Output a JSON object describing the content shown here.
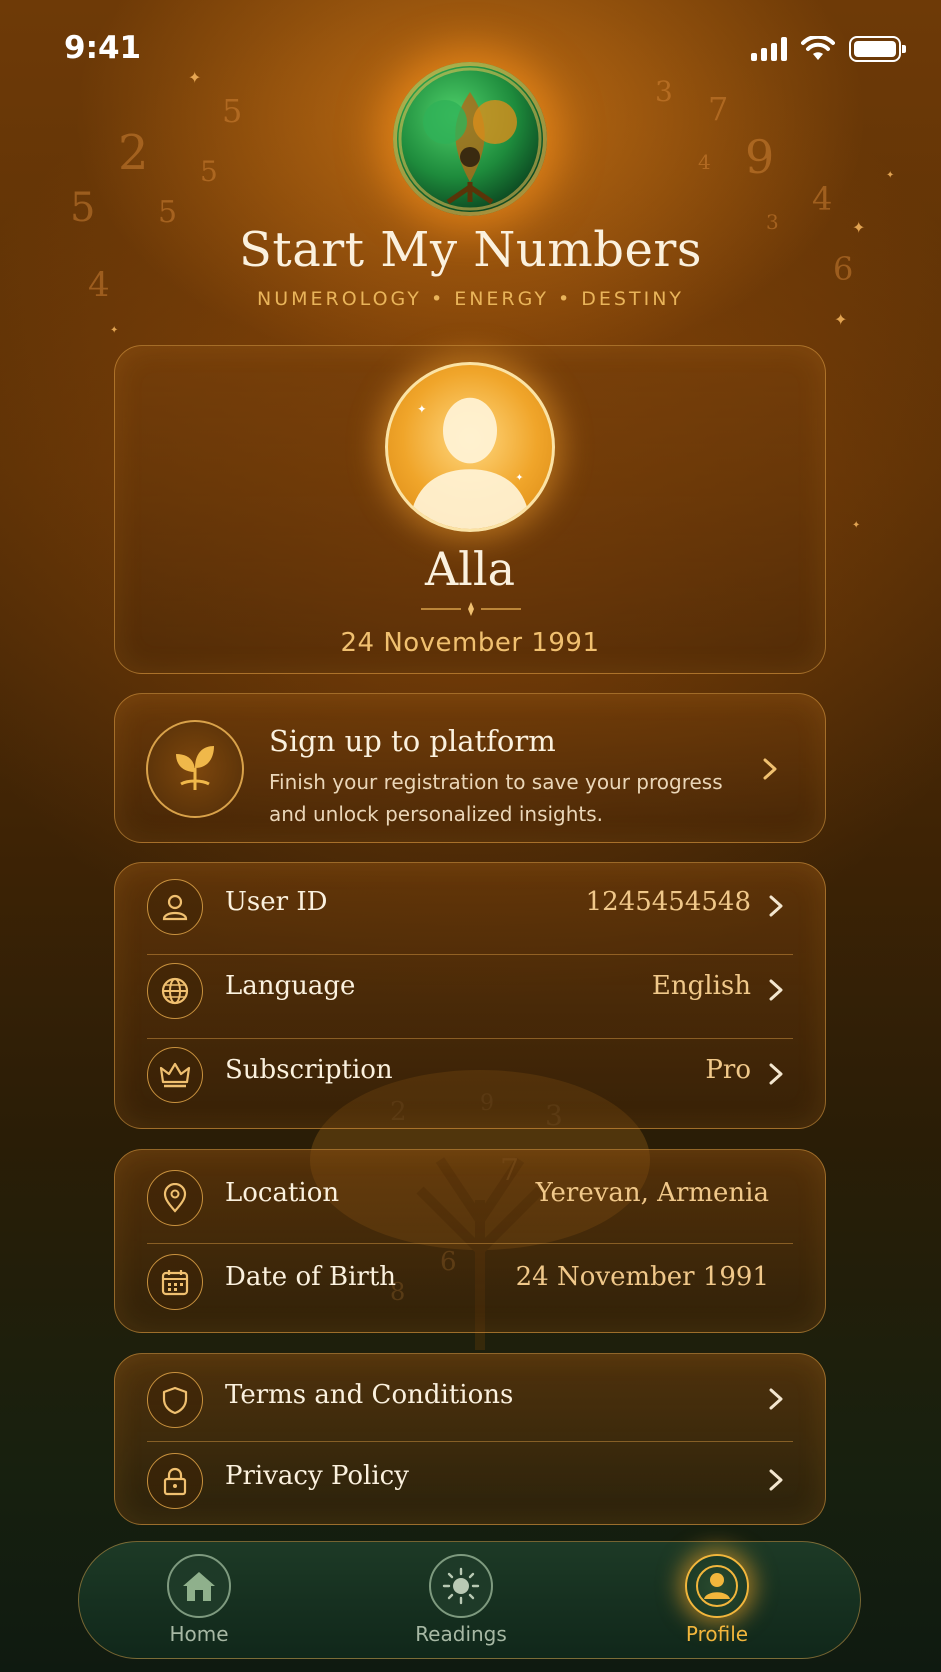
{
  "status_bar": {
    "time": "9:41"
  },
  "header": {
    "title": "Start My Numbers",
    "subtitle": "NUMEROLOGY • ENERGY • DESTINY"
  },
  "profile": {
    "name": "Alla",
    "date_of_birth": "24 November 1991"
  },
  "signup": {
    "title": "Sign up to platform",
    "description": "Finish your registration to save your progress and unlock personalized insights."
  },
  "settings": [
    {
      "label": "User ID",
      "value": "1245454548",
      "icon": "user-icon"
    },
    {
      "label": "Language",
      "value": "English",
      "icon": "globe-icon"
    },
    {
      "label": "Subscription",
      "value": "Pro",
      "icon": "crown-icon"
    }
  ],
  "info": [
    {
      "label": "Location",
      "value": "Yerevan, Armenia",
      "icon": "location-pin-icon"
    },
    {
      "label": "Date of Birth",
      "value": "24 November 1991",
      "icon": "calendar-icon"
    }
  ],
  "legal": [
    {
      "label": "Terms and Conditions",
      "icon": "shield-icon"
    },
    {
      "label": "Privacy Policy",
      "icon": "lock-icon"
    }
  ],
  "tab_bar": {
    "tabs": [
      {
        "label": "Home",
        "icon": "home-icon"
      },
      {
        "label": "Readings",
        "icon": "sun-icon"
      },
      {
        "label": "Profile",
        "icon": "profile-icon"
      }
    ],
    "active": "Profile"
  },
  "colors": {
    "accent": "#f2b63c",
    "gold": "#e9b45a",
    "tab_bg": "#10271a"
  }
}
